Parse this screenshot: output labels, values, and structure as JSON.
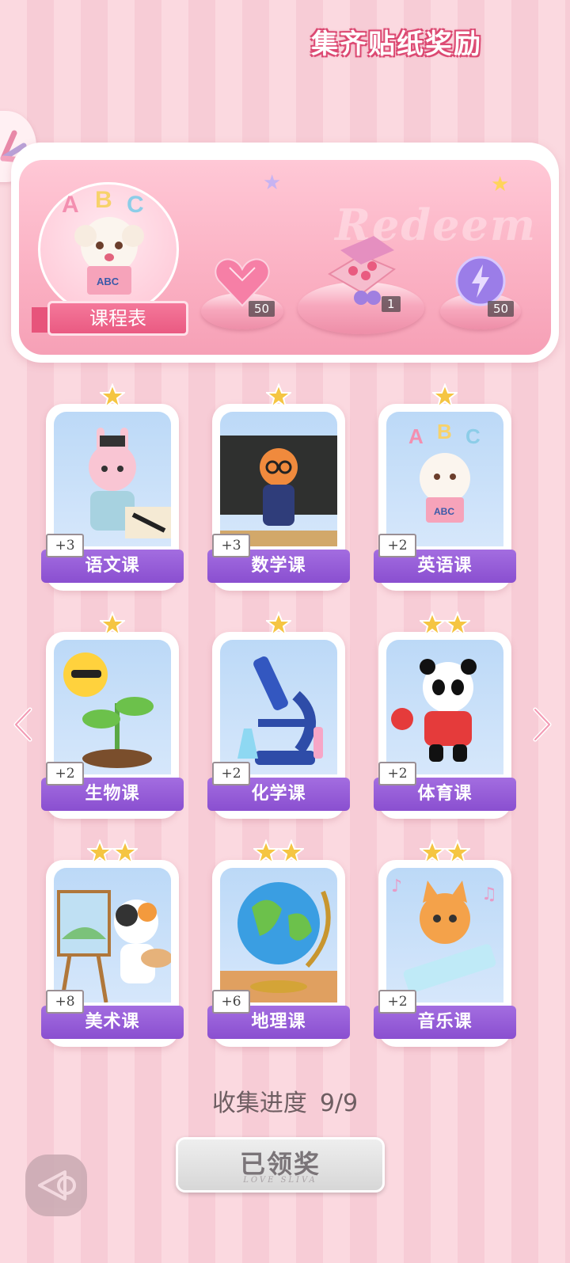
{
  "banner": {
    "title": "集齐贴纸奖励",
    "watermark": "Redeem",
    "schedule_label": "课程表",
    "schedule_art_text": "ABC",
    "rewards": [
      {
        "icon": "heart-gem-icon",
        "count": "50"
      },
      {
        "icon": "gift-box-icon",
        "count": "1"
      },
      {
        "icon": "lightning-orb-icon",
        "count": "50"
      }
    ]
  },
  "cards": [
    {
      "name": "语文课",
      "points": "+3",
      "stars": 1,
      "art": "bunny-calligraphy"
    },
    {
      "name": "数学课",
      "points": "+3",
      "stars": 1,
      "art": "fox-teacher"
    },
    {
      "name": "英语课",
      "points": "+2",
      "stars": 1,
      "art": "puppy-abc"
    },
    {
      "name": "生物课",
      "points": "+2",
      "stars": 1,
      "art": "sun-sprout"
    },
    {
      "name": "化学课",
      "points": "+2",
      "stars": 1,
      "art": "microscope"
    },
    {
      "name": "体育课",
      "points": "+2",
      "stars": 2,
      "art": "panda-pingpong"
    },
    {
      "name": "美术课",
      "points": "+8",
      "stars": 2,
      "art": "cat-painter"
    },
    {
      "name": "地理课",
      "points": "+6",
      "stars": 2,
      "art": "globe"
    },
    {
      "name": "音乐课",
      "points": "+2",
      "stars": 2,
      "art": "cat-keyboard"
    }
  ],
  "progress": {
    "label": "收集进度",
    "value": "9/9"
  },
  "claim_button": {
    "label": "已领奖",
    "sub": "LOVE SLIVA"
  },
  "colors": {
    "accent": "#ea5a82",
    "card_label": "#8a4fd0",
    "star": "#f5c542",
    "background": "#fbd9e0"
  }
}
